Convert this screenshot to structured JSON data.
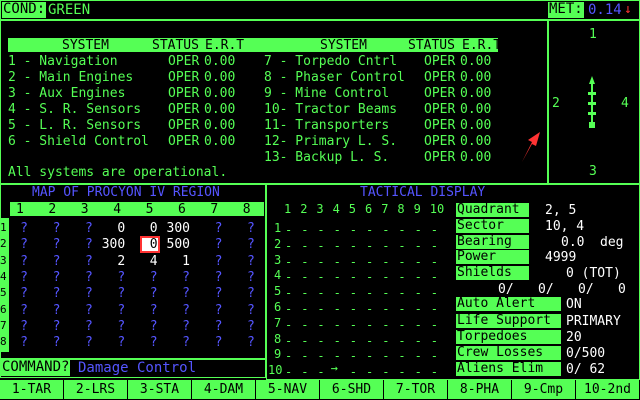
{
  "cond": {
    "label": "COND:",
    "value": "GREEN"
  },
  "met": {
    "label": "MET:",
    "value": "0.14"
  },
  "systems": {
    "headers": [
      "SYSTEM",
      "STATUS",
      "E.R.T"
    ],
    "left": [
      {
        "name": "1 - Navigation",
        "status": "OPER",
        "ert": "0.00"
      },
      {
        "name": "2 - Main Engines",
        "status": "OPER",
        "ert": "0.00"
      },
      {
        "name": "3 - Aux Engines",
        "status": "OPER",
        "ert": "0.00"
      },
      {
        "name": "4 - S. R. Sensors",
        "status": "OPER",
        "ert": "0.00"
      },
      {
        "name": "5 - L. R. Sensors",
        "status": "OPER",
        "ert": "0.00"
      },
      {
        "name": "6 - Shield Control",
        "status": "OPER",
        "ert": "0.00"
      }
    ],
    "right": [
      {
        "name": "7 - Torpedo Cntrl",
        "status": "OPER",
        "ert": "0.00"
      },
      {
        "name": "8 - Phaser Control",
        "status": "OPER",
        "ert": "0.00"
      },
      {
        "name": "9 - Mine Control",
        "status": "OPER",
        "ert": "0.00"
      },
      {
        "name": "10- Tractor Beams",
        "status": "OPER",
        "ert": "0.00"
      },
      {
        "name": "11- Transporters",
        "status": "OPER",
        "ert": "0.00"
      },
      {
        "name": "12- Primary L. S.",
        "status": "OPER",
        "ert": "0.00"
      },
      {
        "name": "13- Backup L. S.",
        "status": "OPER",
        "ert": "0.00"
      }
    ],
    "message": "All systems are operational."
  },
  "compass": {
    "n": "1",
    "e": "4",
    "s": "3",
    "w": "2"
  },
  "map": {
    "title": "MAP OF PROCYON IV REGION",
    "cols": [
      "1",
      "2",
      "3",
      "4",
      "5",
      "6",
      "7",
      "8"
    ],
    "rows": [
      "1",
      "2",
      "3",
      "4",
      "5",
      "6",
      "7",
      "8"
    ],
    "cells": [
      [
        "?",
        "?",
        "?",
        "0",
        "0",
        "300",
        "?",
        "?"
      ],
      [
        "?",
        "?",
        "?",
        "300",
        "0",
        "500",
        "?",
        "?"
      ],
      [
        "?",
        "?",
        "?",
        "2",
        "4",
        "1",
        "?",
        "?"
      ],
      [
        "?",
        "?",
        "?",
        "?",
        "?",
        "?",
        "?",
        "?"
      ],
      [
        "?",
        "?",
        "?",
        "?",
        "?",
        "?",
        "?",
        "?"
      ],
      [
        "?",
        "?",
        "?",
        "?",
        "?",
        "?",
        "?",
        "?"
      ],
      [
        "?",
        "?",
        "?",
        "?",
        "?",
        "?",
        "?",
        "?"
      ],
      [
        "?",
        "?",
        "?",
        "?",
        "?",
        "?",
        "?",
        "?"
      ]
    ]
  },
  "command": {
    "label": "COMMAND?",
    "value": "Damage Control"
  },
  "tactical": {
    "title": "TACTICAL DISPLAY",
    "cols": [
      "1",
      "2",
      "3",
      "4",
      "5",
      "6",
      "7",
      "8",
      "9",
      "10"
    ],
    "rows": [
      "1",
      "2",
      "3",
      "4",
      "5",
      "6",
      "7",
      "8",
      "9",
      "10"
    ],
    "ship_glyph": "→"
  },
  "status": {
    "quadrant": {
      "label": "Quadrant",
      "value": "2, 5"
    },
    "sector": {
      "label": "Sector",
      "value": "10, 4"
    },
    "bearing": {
      "label": "Bearing",
      "value": "0.0",
      "unit": "deg"
    },
    "power": {
      "label": "Power",
      "value": "4999"
    },
    "shields": {
      "label": "Shields",
      "value": "0 (TOT)",
      "parts": [
        "0/",
        "0/",
        "0/",
        "0"
      ]
    },
    "auto_alert": {
      "label": "Auto Alert",
      "value": "ON"
    },
    "life_support": {
      "label": "Life Support",
      "value": "PRIMARY"
    },
    "torpedoes": {
      "label": "Torpedoes",
      "value": "20"
    },
    "crew_losses": {
      "label": "Crew Losses",
      "value": "0/500"
    },
    "aliens_elim": {
      "label": "Aliens Elim",
      "value": "0/ 62"
    }
  },
  "fkeys": [
    "1-TAR",
    "2-LRS",
    "3-STA",
    "4-DAM",
    "5-NAV",
    "6-SHD",
    "7-TOR",
    "8-PHA",
    "9-Cmp",
    "10-2nd"
  ],
  "colors": {
    "green": "#55ff55",
    "white": "#ffffff",
    "blue": "#5555ff",
    "red": "#ff3333"
  }
}
